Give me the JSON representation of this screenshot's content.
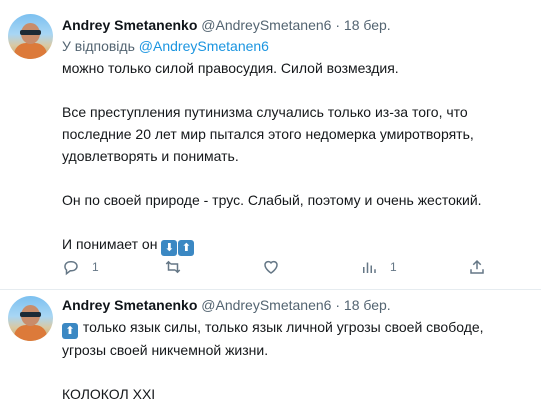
{
  "tweets": [
    {
      "name": "Andrey Smetanenko",
      "handle": "@AndreySmetanen6",
      "separator": "·",
      "date": "18 бер.",
      "reply_prefix": "У відповідь",
      "reply_handle": "@AndreySmetanen6",
      "lines": [
        "можно только силой правосудия. Силой возмездия.",
        "Все преступления путинизма случались только из-за того, что",
        "последние 20 лет мир пытался этого недомерка умиротворять,",
        "удовлетворять и понимать.",
        "Он по своей природе - трус. Слабый, поэтому и очень жестокий.",
        "И понимает он"
      ],
      "emoji": [
        "arrow-down-emoji",
        "arrow-up-emoji"
      ],
      "actions": {
        "reply_count": "1",
        "retweet_count": "",
        "like_count": "",
        "stats_count": "1"
      }
    },
    {
      "name": "Andrey Smetanenko",
      "handle": "@AndreySmetanen6",
      "separator": "·",
      "date": "18 бер.",
      "emoji": [
        "arrow-up-emoji"
      ],
      "lines": [
        "только язык силы, только язык личной угрозы своей свободе,",
        "угрозы своей никчемной жизни.",
        "КОЛОКОЛ XXI"
      ]
    }
  ],
  "colors": {
    "link": "#1b95e0",
    "secondary_text": "#536471",
    "emoji_bg": "#3b88c3",
    "divider": "#e6ecf0"
  }
}
